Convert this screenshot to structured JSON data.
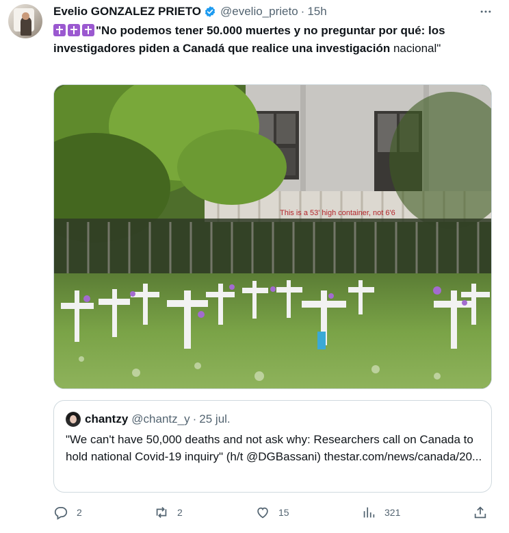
{
  "tweet": {
    "author_name": "Evelio GONZALEZ PRIETO",
    "handle": "@evelio_prieto",
    "separator": "·",
    "time": "15h",
    "text_bold": "\"No podemos tener 50.000 muertes y no preguntar por qué: los investigadores piden a Canadá que realice una investigación",
    "text_rest": "nacional\"",
    "emoji": [
      "latin-cross-emoji",
      "latin-cross-emoji",
      "latin-cross-emoji"
    ],
    "image_overlay_text": "This is a 53' high container, not 6'6"
  },
  "quote": {
    "author_name": "chantzy",
    "handle": "@chantz_y",
    "separator": "·",
    "time": "25 jul.",
    "text": "\"We can't have 50,000 deaths and not ask why: Researchers call on Canada to hold national Covid-19 inquiry\" (h/t @DGBassani) thestar.com/news/canada/20..."
  },
  "actions": {
    "replies": "2",
    "retweets": "2",
    "likes": "15",
    "views": "321"
  },
  "colors": {
    "text": "#0f1419",
    "secondary": "#536471",
    "verified": "#1d9bf0",
    "border": "#cfd9de",
    "emoji_bg": "#9b59d0"
  }
}
